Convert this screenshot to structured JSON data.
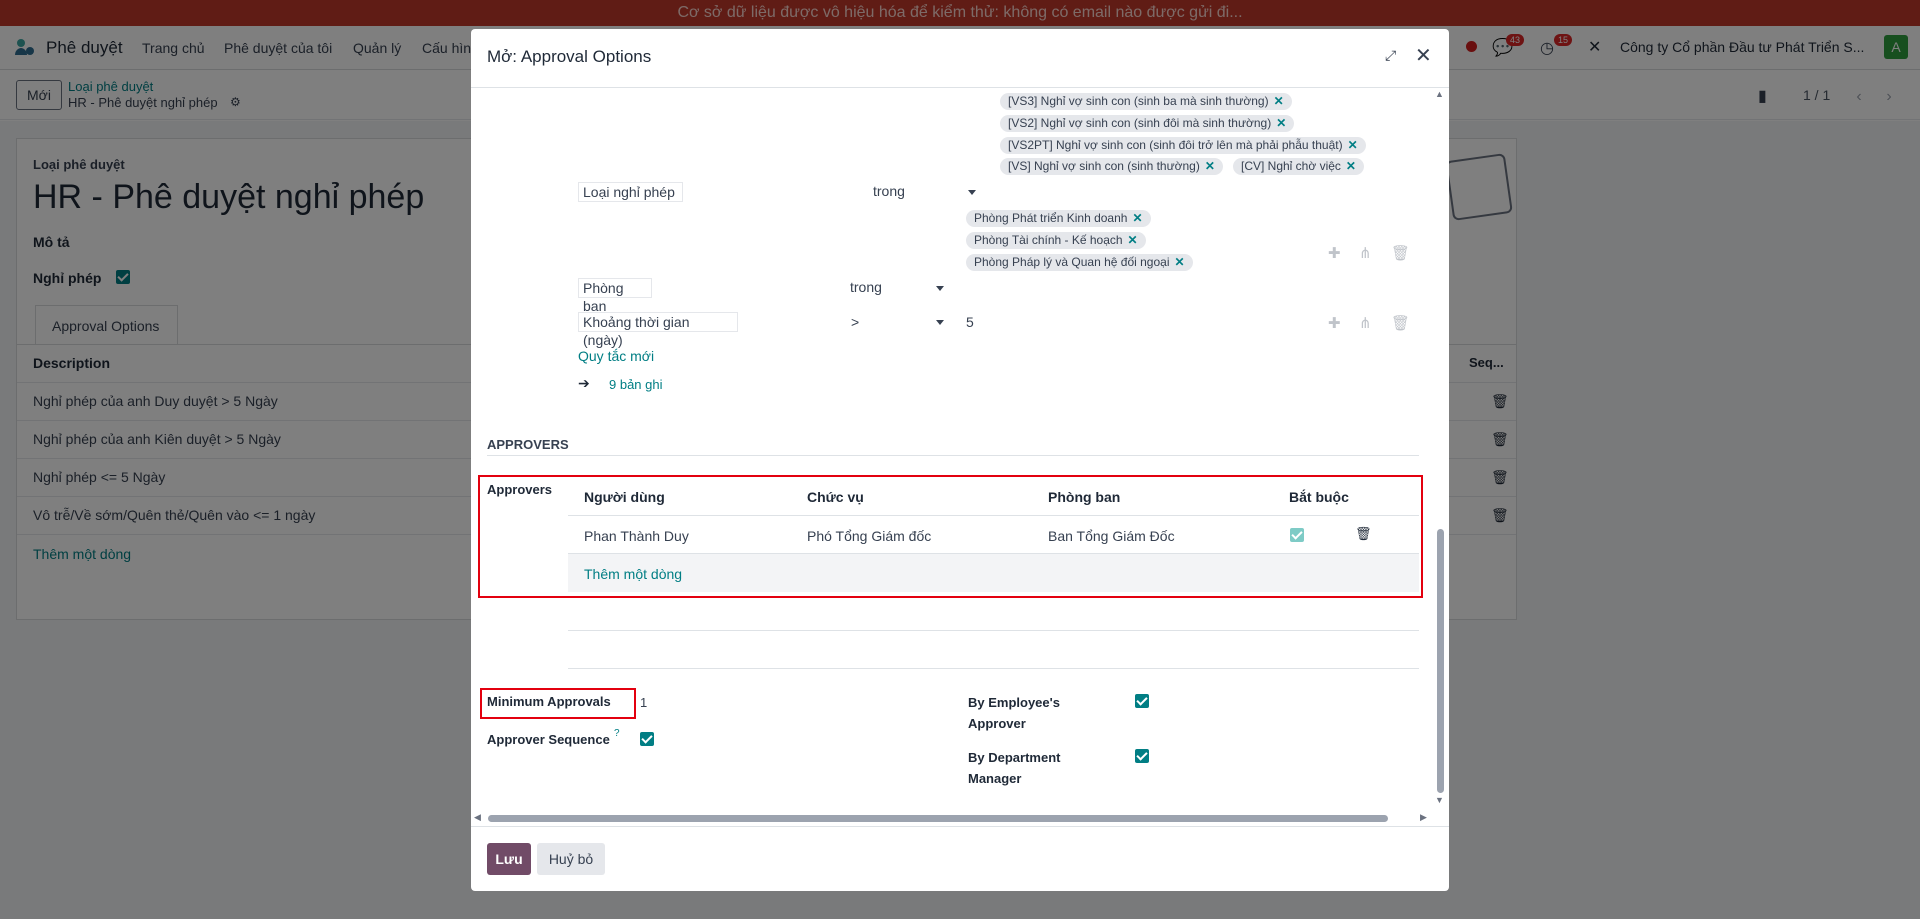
{
  "banner": {
    "text": "Cơ sở dữ liệu được vô hiệu hóa để kiểm thử: không có email nào được gửi đi..."
  },
  "navbar": {
    "app_name": "Phê duyệt",
    "menu": [
      "Trang chủ",
      "Phê duyệt của tôi",
      "Quản lý",
      "Cấu hìn"
    ],
    "messages_badge": "43",
    "activities_badge": "15",
    "company": "Công ty Cổ phần Đầu tư Phát Triển S...",
    "avatar": "A"
  },
  "control": {
    "new_label": "Mới",
    "breadcrumb_parent": "Loại phê duyệt",
    "breadcrumb_current": "HR - Phê duyệt nghỉ phép",
    "pager": "1 / 1"
  },
  "background_form": {
    "type_label": "Loại phê duyệt",
    "title": "HR - Phê duyệt nghỉ phép",
    "desc_label": "Mô tả",
    "leave_label": "Nghỉ phép",
    "tab": "Approval Options",
    "col_description": "Description",
    "col_seq": "Seq...",
    "rows": [
      "Nghỉ phép của anh Duy duyệt > 5 Ngày",
      "Nghỉ phép của anh Kiên duyệt > 5 Ngày",
      "Nghỉ phép <= 5 Ngày",
      "Vô trễ/Về sớm/Quên thẻ/Quên vào <= 1 ngày"
    ],
    "add_line": "Thêm một dòng"
  },
  "modal": {
    "title": "Mở: Approval Options",
    "tags_leave": [
      "[VS3] Nghỉ vợ sinh con (sinh ba mà sinh thường)",
      "[VS2] Nghỉ vợ sinh con (sinh đôi mà sinh thường)",
      "[VS2PT] Nghỉ vợ sinh con (sinh đôi trở lên mà phải phẫu thuật)",
      "[VS] Nghỉ vợ sinh con (sinh thường)",
      "[CV] Nghỉ chờ việc"
    ],
    "tags_dept": [
      "Phòng Phát triển Kinh doanh",
      "Phòng Tài chính - Kế hoạch",
      "Phòng Pháp lý và Quan hệ đối ngoại"
    ],
    "rules": [
      {
        "field": "Loại nghỉ phép",
        "op": "trong",
        "value": ""
      },
      {
        "field": "Phòng ban",
        "op": "trong",
        "value": ""
      },
      {
        "field": "Khoảng thời gian (ngày)",
        "op": ">",
        "value": "5"
      }
    ],
    "new_rule": "Quy tắc mới",
    "records": "9 bản ghi",
    "approvers_section": "APPROVERS",
    "approvers_label": "Approvers",
    "approvers_cols": [
      "Người dùng",
      "Chức vụ",
      "Phòng ban",
      "Bắt buộc"
    ],
    "approvers_rows": [
      {
        "user": "Phan Thành Duy",
        "position": "Phó Tổng Giám đốc",
        "department": "Ban Tổng Giám Đốc"
      }
    ],
    "add_line": "Thêm một dòng",
    "min_approvals_label": "Minimum Approvals",
    "min_approvals_value": "1",
    "approver_sequence_label": "Approver Sequence",
    "help_mark": "?",
    "by_emp_label_1": "By Employee's",
    "by_emp_label_2": "Approver",
    "by_dept_label_1": "By Department",
    "by_dept_label_2": "Manager",
    "save": "Lưu",
    "cancel": "Huỷ bỏ"
  },
  "colors": {
    "banner": "#c0392b",
    "primary": "#714b67",
    "teal": "#017e84",
    "highlight": "#e3000f"
  }
}
